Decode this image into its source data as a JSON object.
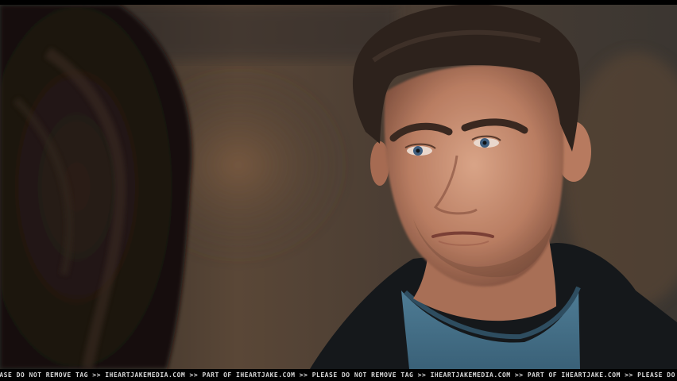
{
  "scene": {
    "description_icon": "film-still-photo"
  },
  "watermark": {
    "text": "EASE DO NOT REMOVE TAG >> IHEARTJAKEMEDIA.COM >> PART OF IHEARTJAKE.COM >> PLEASE DO NOT REMOVE TAG >> IHEARTJAKEMEDIA.COM >> PART OF IHEARTJAKE.COM >> PLEASE DO NOT REMOVE TAG >> IHEARTJAKE"
  }
}
